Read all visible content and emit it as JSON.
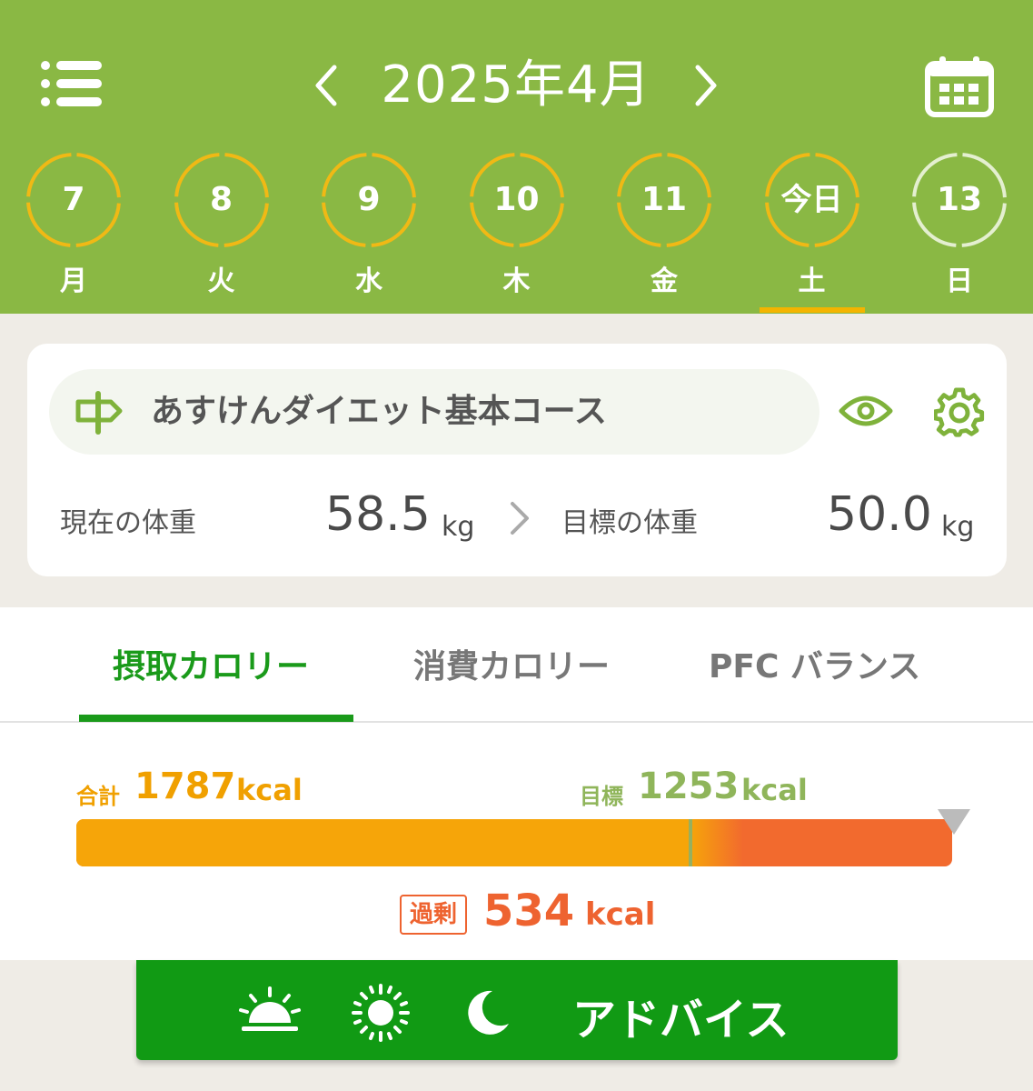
{
  "header": {
    "title": "2025年4月",
    "bg_color": "#8ab844",
    "days": [
      {
        "num": "7",
        "weekday": "月",
        "status": "past"
      },
      {
        "num": "8",
        "weekday": "火",
        "status": "past"
      },
      {
        "num": "9",
        "weekday": "水",
        "status": "past"
      },
      {
        "num": "10",
        "weekday": "木",
        "status": "past"
      },
      {
        "num": "11",
        "weekday": "金",
        "status": "past"
      },
      {
        "num": "今日",
        "weekday": "土",
        "status": "today"
      },
      {
        "num": "13",
        "weekday": "日",
        "status": "future"
      }
    ],
    "selected_day_index": 5
  },
  "course": {
    "name": "あすけんダイエット基本コース",
    "current_label": "現在の体重",
    "current_value": "58.5",
    "current_unit": "kg",
    "goal_label": "目標の体重",
    "goal_value": "50.0",
    "goal_unit": "kg"
  },
  "tabs": [
    {
      "label": "摂取カロリー",
      "active": true
    },
    {
      "label": "消費カロリー",
      "active": false
    },
    {
      "label": "PFC バランス",
      "active": false
    }
  ],
  "calorie": {
    "total_label": "合計",
    "total_value": "1787",
    "total_unit": "kcal",
    "target_label": "目標",
    "target_value": "1253",
    "target_unit": "kcal",
    "excess_label": "過剰",
    "excess_value": "534",
    "excess_unit": "kcal",
    "total_num": 1787,
    "target_num": 1253,
    "colors": {
      "intake": "#f6a509",
      "excess": "#f26a2e",
      "target": "#8fb55a"
    }
  },
  "advice": {
    "label": "アドバイス",
    "icons": [
      "sunrise-icon",
      "sun-icon",
      "moon-icon"
    ]
  }
}
